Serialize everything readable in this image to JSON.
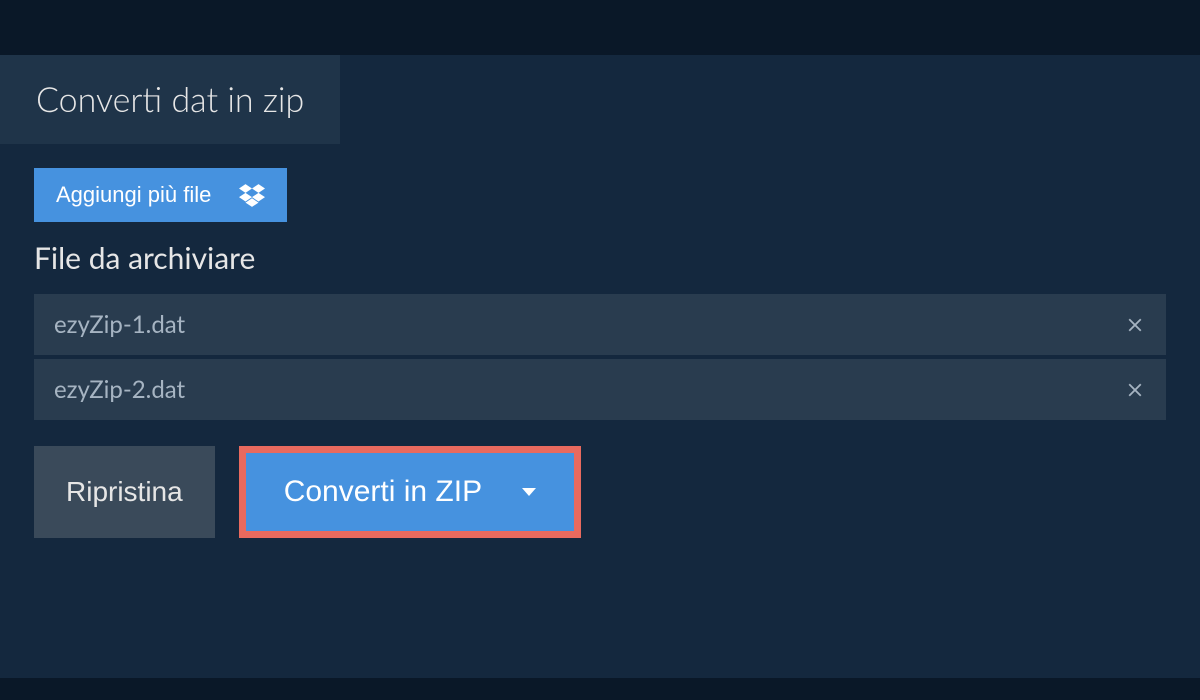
{
  "tab": {
    "label": "Converti dat in zip"
  },
  "addFilesButton": {
    "label": "Aggiungi più file"
  },
  "sectionTitle": "File da archiviare",
  "files": [
    {
      "name": "ezyZip-1.dat"
    },
    {
      "name": "ezyZip-2.dat"
    }
  ],
  "restoreButton": {
    "label": "Ripristina"
  },
  "convertButton": {
    "label": "Converti in ZIP"
  }
}
